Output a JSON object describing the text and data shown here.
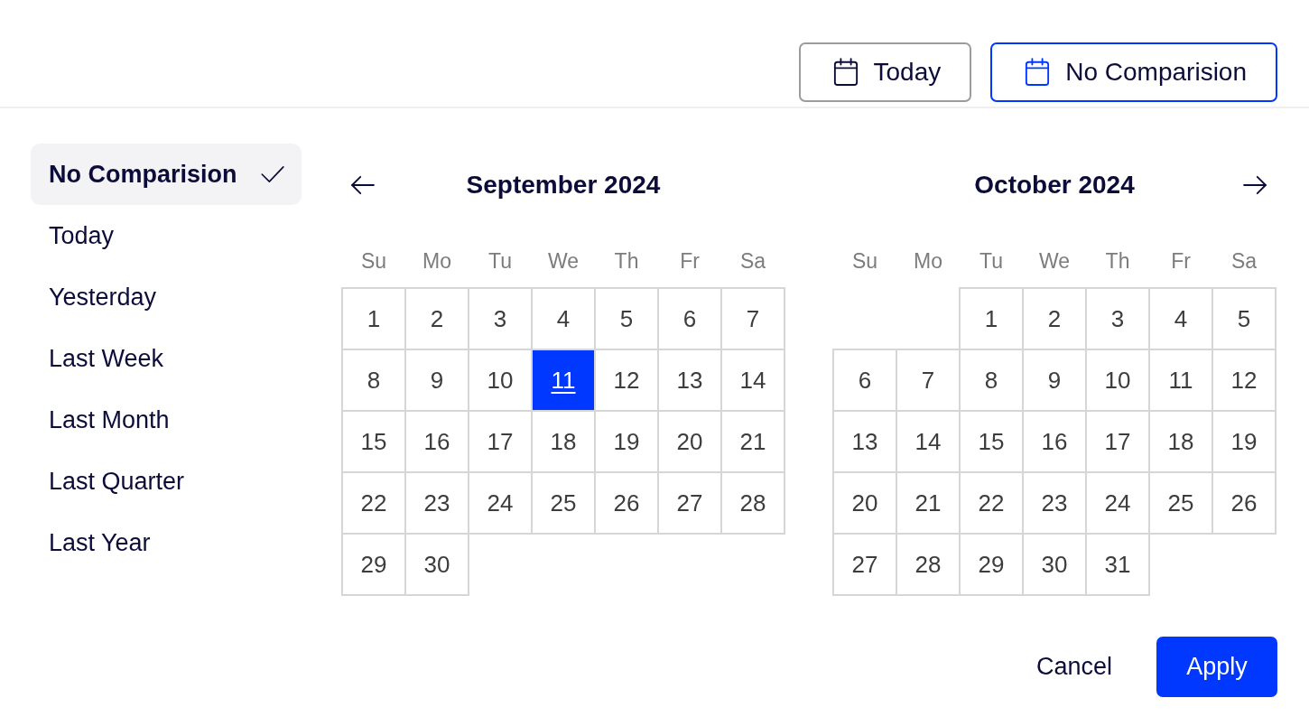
{
  "top_bar": {
    "buttons": [
      {
        "label": "Today",
        "active": false
      },
      {
        "label": "No Comparision",
        "active": true
      }
    ]
  },
  "presets": [
    {
      "label": "No Comparision",
      "selected": true
    },
    {
      "label": "Today",
      "selected": false
    },
    {
      "label": "Yesterday",
      "selected": false
    },
    {
      "label": "Last Week",
      "selected": false
    },
    {
      "label": "Last Month",
      "selected": false
    },
    {
      "label": "Last Quarter",
      "selected": false
    },
    {
      "label": "Last Year",
      "selected": false
    }
  ],
  "calendars": [
    {
      "title": "September 2024",
      "weekdays": [
        "Su",
        "Mo",
        "Tu",
        "We",
        "Th",
        "Fr",
        "Sa"
      ],
      "weeks": [
        [
          {
            "label": "1",
            "selected": false
          },
          {
            "label": "2",
            "selected": false
          },
          {
            "label": "3",
            "selected": false
          },
          {
            "label": "4",
            "selected": false
          },
          {
            "label": "5",
            "selected": false
          },
          {
            "label": "6",
            "selected": false
          },
          {
            "label": "7",
            "selected": false
          }
        ],
        [
          {
            "label": "8",
            "selected": false
          },
          {
            "label": "9",
            "selected": false
          },
          {
            "label": "10",
            "selected": false
          },
          {
            "label": "11",
            "selected": true
          },
          {
            "label": "12",
            "selected": false
          },
          {
            "label": "13",
            "selected": false
          },
          {
            "label": "14",
            "selected": false
          }
        ],
        [
          {
            "label": "15",
            "selected": false
          },
          {
            "label": "16",
            "selected": false
          },
          {
            "label": "17",
            "selected": false
          },
          {
            "label": "18",
            "selected": false
          },
          {
            "label": "19",
            "selected": false
          },
          {
            "label": "20",
            "selected": false
          },
          {
            "label": "21",
            "selected": false
          }
        ],
        [
          {
            "label": "22",
            "selected": false
          },
          {
            "label": "23",
            "selected": false
          },
          {
            "label": "24",
            "selected": false
          },
          {
            "label": "25",
            "selected": false
          },
          {
            "label": "26",
            "selected": false
          },
          {
            "label": "27",
            "selected": false
          },
          {
            "label": "28",
            "selected": false
          }
        ],
        [
          {
            "label": "29",
            "selected": false
          },
          {
            "label": "30",
            "selected": false
          }
        ]
      ]
    },
    {
      "title": "October 2024",
      "weekdays": [
        "Su",
        "Mo",
        "Tu",
        "We",
        "Th",
        "Fr",
        "Sa"
      ],
      "weeks": [
        [
          {
            "label": "1",
            "selected": false
          },
          {
            "label": "2",
            "selected": false
          },
          {
            "label": "3",
            "selected": false
          },
          {
            "label": "4",
            "selected": false
          },
          {
            "label": "5",
            "selected": false
          }
        ],
        [
          {
            "label": "6",
            "selected": false
          },
          {
            "label": "7",
            "selected": false
          },
          {
            "label": "8",
            "selected": false
          },
          {
            "label": "9",
            "selected": false
          },
          {
            "label": "10",
            "selected": false
          },
          {
            "label": "11",
            "selected": false
          },
          {
            "label": "12",
            "selected": false
          }
        ],
        [
          {
            "label": "13",
            "selected": false
          },
          {
            "label": "14",
            "selected": false
          },
          {
            "label": "15",
            "selected": false
          },
          {
            "label": "16",
            "selected": false
          },
          {
            "label": "17",
            "selected": false
          },
          {
            "label": "18",
            "selected": false
          },
          {
            "label": "19",
            "selected": false
          }
        ],
        [
          {
            "label": "20",
            "selected": false
          },
          {
            "label": "21",
            "selected": false
          },
          {
            "label": "22",
            "selected": false
          },
          {
            "label": "23",
            "selected": false
          },
          {
            "label": "24",
            "selected": false
          },
          {
            "label": "25",
            "selected": false
          },
          {
            "label": "26",
            "selected": false
          }
        ],
        [
          {
            "label": "27",
            "selected": false
          },
          {
            "label": "28",
            "selected": false
          },
          {
            "label": "29",
            "selected": false
          },
          {
            "label": "30",
            "selected": false
          },
          {
            "label": "31",
            "selected": false
          }
        ]
      ]
    }
  ],
  "footer": {
    "cancel": "Cancel",
    "apply": "Apply"
  }
}
